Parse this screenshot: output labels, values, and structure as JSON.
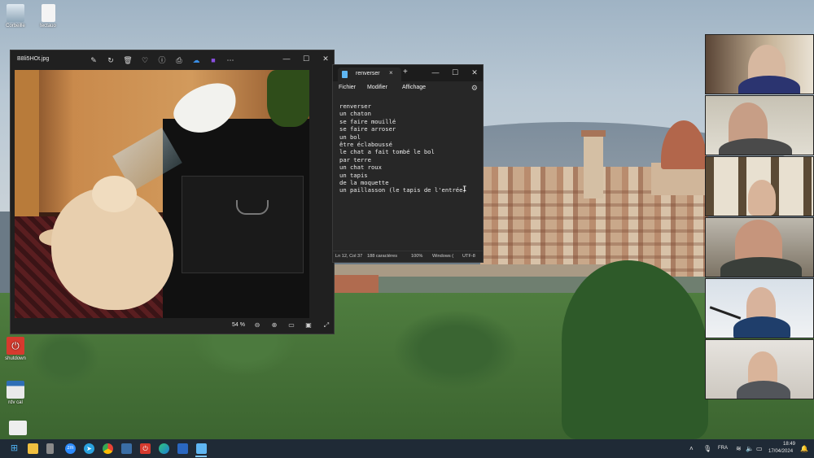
{
  "desktop": {
    "icons": [
      {
        "label": "Corbeille"
      },
      {
        "label": "tectauo"
      },
      {
        "label": "shutdown"
      },
      {
        "label": "rdv cal"
      }
    ]
  },
  "photos_window": {
    "filename": "B8li5HOt.jpg",
    "zoom": "54 %",
    "toolbar_icons": [
      "edit-icon",
      "rotate-icon",
      "delete-icon",
      "favorite-icon",
      "info-icon",
      "print-icon",
      "onedrive-icon",
      "clipchamp-icon",
      "more-icon"
    ]
  },
  "notepad": {
    "tab_title": "renverser",
    "menu": {
      "file": "Fichier",
      "edit": "Modifier",
      "view": "Affichage"
    },
    "content": "renverser\nun chaton\nse faire mouillé\nse faire arroser\nun bol\nêtre éclaboussé\nle chat a fait tombé le bol\npar terre\nun chat roux\nun tapis\nde la moquette\nun paillasson (le tapis de l'entrée)",
    "status": {
      "position": "Ln 12, Col 37",
      "chars": "188 caractères",
      "zoom": "100%",
      "eol": "Windows (",
      "encoding": "UTF-8"
    }
  },
  "taskbar": {
    "language": "FRA",
    "time": "18:49",
    "date": "17/04/2024"
  },
  "colors": {
    "taskbar": "#1f2a36",
    "window_dark": "#202020",
    "notepad_bg": "#272727",
    "accent": "#5fb6f2"
  }
}
